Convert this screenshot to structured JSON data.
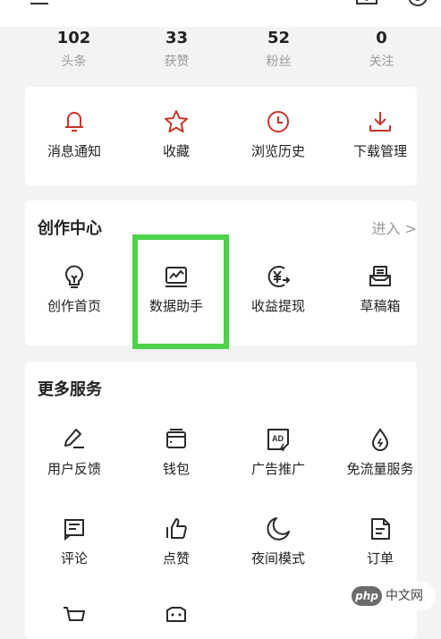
{
  "stats": [
    {
      "value": "102",
      "label": "头条"
    },
    {
      "value": "33",
      "label": "获赞"
    },
    {
      "value": "52",
      "label": "粉丝"
    },
    {
      "value": "0",
      "label": "关注"
    }
  ],
  "quick": [
    {
      "label": "消息通知",
      "icon": "bell-icon"
    },
    {
      "label": "收藏",
      "icon": "star-icon"
    },
    {
      "label": "浏览历史",
      "icon": "clock-icon"
    },
    {
      "label": "下载管理",
      "icon": "download-icon"
    }
  ],
  "creation": {
    "title": "创作中心",
    "enter": "进入 >",
    "items": [
      {
        "label": "创作首页",
        "icon": "lightbulb-icon"
      },
      {
        "label": "数据助手",
        "icon": "chart-icon"
      },
      {
        "label": "收益提现",
        "icon": "yuan-icon"
      },
      {
        "label": "草稿箱",
        "icon": "drafts-icon"
      }
    ]
  },
  "services": {
    "title": "更多服务",
    "items": [
      {
        "label": "用户反馈",
        "icon": "pen-icon"
      },
      {
        "label": "钱包",
        "icon": "wallet-icon"
      },
      {
        "label": "广告推广",
        "icon": "ad-icon"
      },
      {
        "label": "免流量服务",
        "icon": "drop-icon"
      },
      {
        "label": "评论",
        "icon": "comment-icon"
      },
      {
        "label": "点赞",
        "icon": "thumbs-up-icon"
      },
      {
        "label": "夜间模式",
        "icon": "moon-icon"
      },
      {
        "label": "订单",
        "icon": "order-icon"
      }
    ]
  },
  "watermark": {
    "badge": "php",
    "text": "中文网"
  },
  "colors": {
    "accent_red": "#c9352b",
    "icon_dark": "#2a2a2a",
    "highlight_green": "#4fd24b"
  }
}
